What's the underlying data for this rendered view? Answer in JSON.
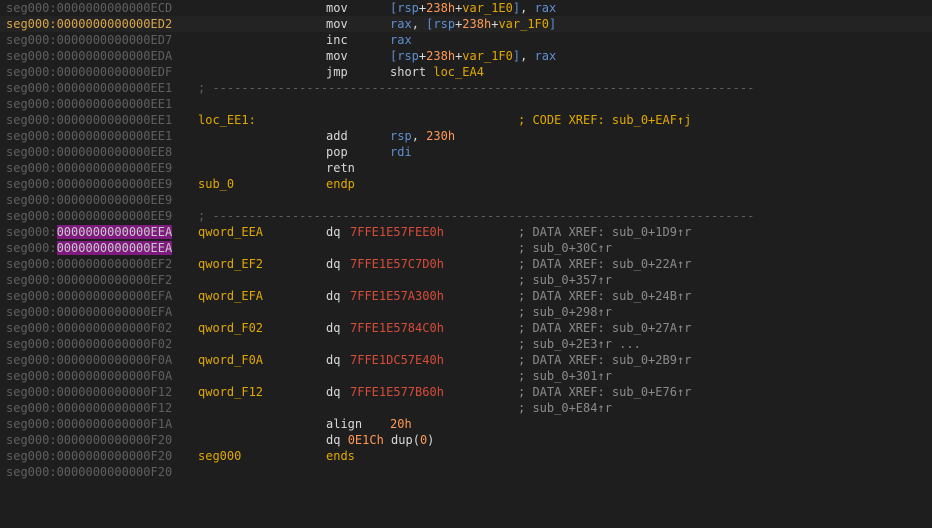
{
  "segment_prefix": "seg000:",
  "addresses": {
    "ecd": "0000000000000ECD",
    "ed2": "0000000000000ED2",
    "ed7": "0000000000000ED7",
    "eda": "0000000000000EDA",
    "edf": "0000000000000EDF",
    "ee1": "0000000000000EE1",
    "ee8": "0000000000000EE8",
    "ee9": "0000000000000EE9",
    "eea": "0000000000000EEA",
    "ef2": "0000000000000EF2",
    "efa": "0000000000000EFA",
    "f02": "0000000000000F02",
    "f0a": "0000000000000F0A",
    "f12": "0000000000000F12",
    "f1a": "0000000000000F1A",
    "f20": "0000000000000F20"
  },
  "instr": {
    "mov": "mov",
    "inc": "inc",
    "jmp": "jmp",
    "add": "add",
    "pop": "pop",
    "retn": "retn",
    "dq": "dq",
    "align": "align",
    "endp": "endp",
    "ends": "ends"
  },
  "tokens": {
    "lbr": "[",
    "rbr": "]",
    "plus": "+",
    "comma_sp": ", ",
    "rsp": "rsp",
    "rax": "rax",
    "rdi": "rdi",
    "h238": "238h",
    "h230": "230h",
    "var_1e0": "var_1E0",
    "var_1f0": "var_1F0",
    "short": "short ",
    "loc_ea4": "loc_EA4",
    "align_val": "20h",
    "dup_count": "0E1Ch",
    "dup_open": " dup(",
    "dup_val": "0",
    "dup_close": ")"
  },
  "labels": {
    "loc_ee1": "loc_EE1:",
    "sub_0": "sub_0",
    "qword_eea": "qword_EEA",
    "qword_ef2": "qword_EF2",
    "qword_efa": "qword_EFA",
    "qword_f02": "qword_F02",
    "qword_f0a": "qword_F0A",
    "qword_f12": "qword_F12",
    "seg000": "seg000"
  },
  "separator": "; ---------------------------------------------------------------------------",
  "data_values": {
    "eea": "7FFE1E57FEE0h",
    "ef2": "7FFE1E57C7D0h",
    "efa": "7FFE1E57A300h",
    "f02": "7FFE1E5784C0h",
    "f0a": "7FFE1DC57E40h",
    "f12": "7FFE1E577B60h"
  },
  "comments": {
    "code_xref": "; CODE XREF: sub_0+EAF↑j",
    "eea_1": "; DATA XREF: sub_0+1D9↑r",
    "eea_2": "; sub_0+30C↑r",
    "ef2_1": "; DATA XREF: sub_0+22A↑r",
    "ef2_2": "; sub_0+357↑r",
    "efa_1": "; DATA XREF: sub_0+24B↑r",
    "efa_2": "; sub_0+298↑r",
    "f02_1": "; DATA XREF: sub_0+27A↑r",
    "f02_2": "; sub_0+2E3↑r ...",
    "f0a_1": "; DATA XREF: sub_0+2B9↑r",
    "f0a_2": "; sub_0+301↑r",
    "f12_1": "; DATA XREF: sub_0+E76↑r",
    "f12_2": "; sub_0+E84↑r"
  },
  "colors": {
    "background": "#1e1e1e",
    "address_gray": "#5f5f5f",
    "selected_address": "#d9a64a",
    "label_yellow": "#e0a800",
    "register_blue": "#5e8fcf",
    "number_orange": "#ff9955",
    "data_red": "#d64b3a",
    "highlight_magenta": "#7f1a7f"
  }
}
